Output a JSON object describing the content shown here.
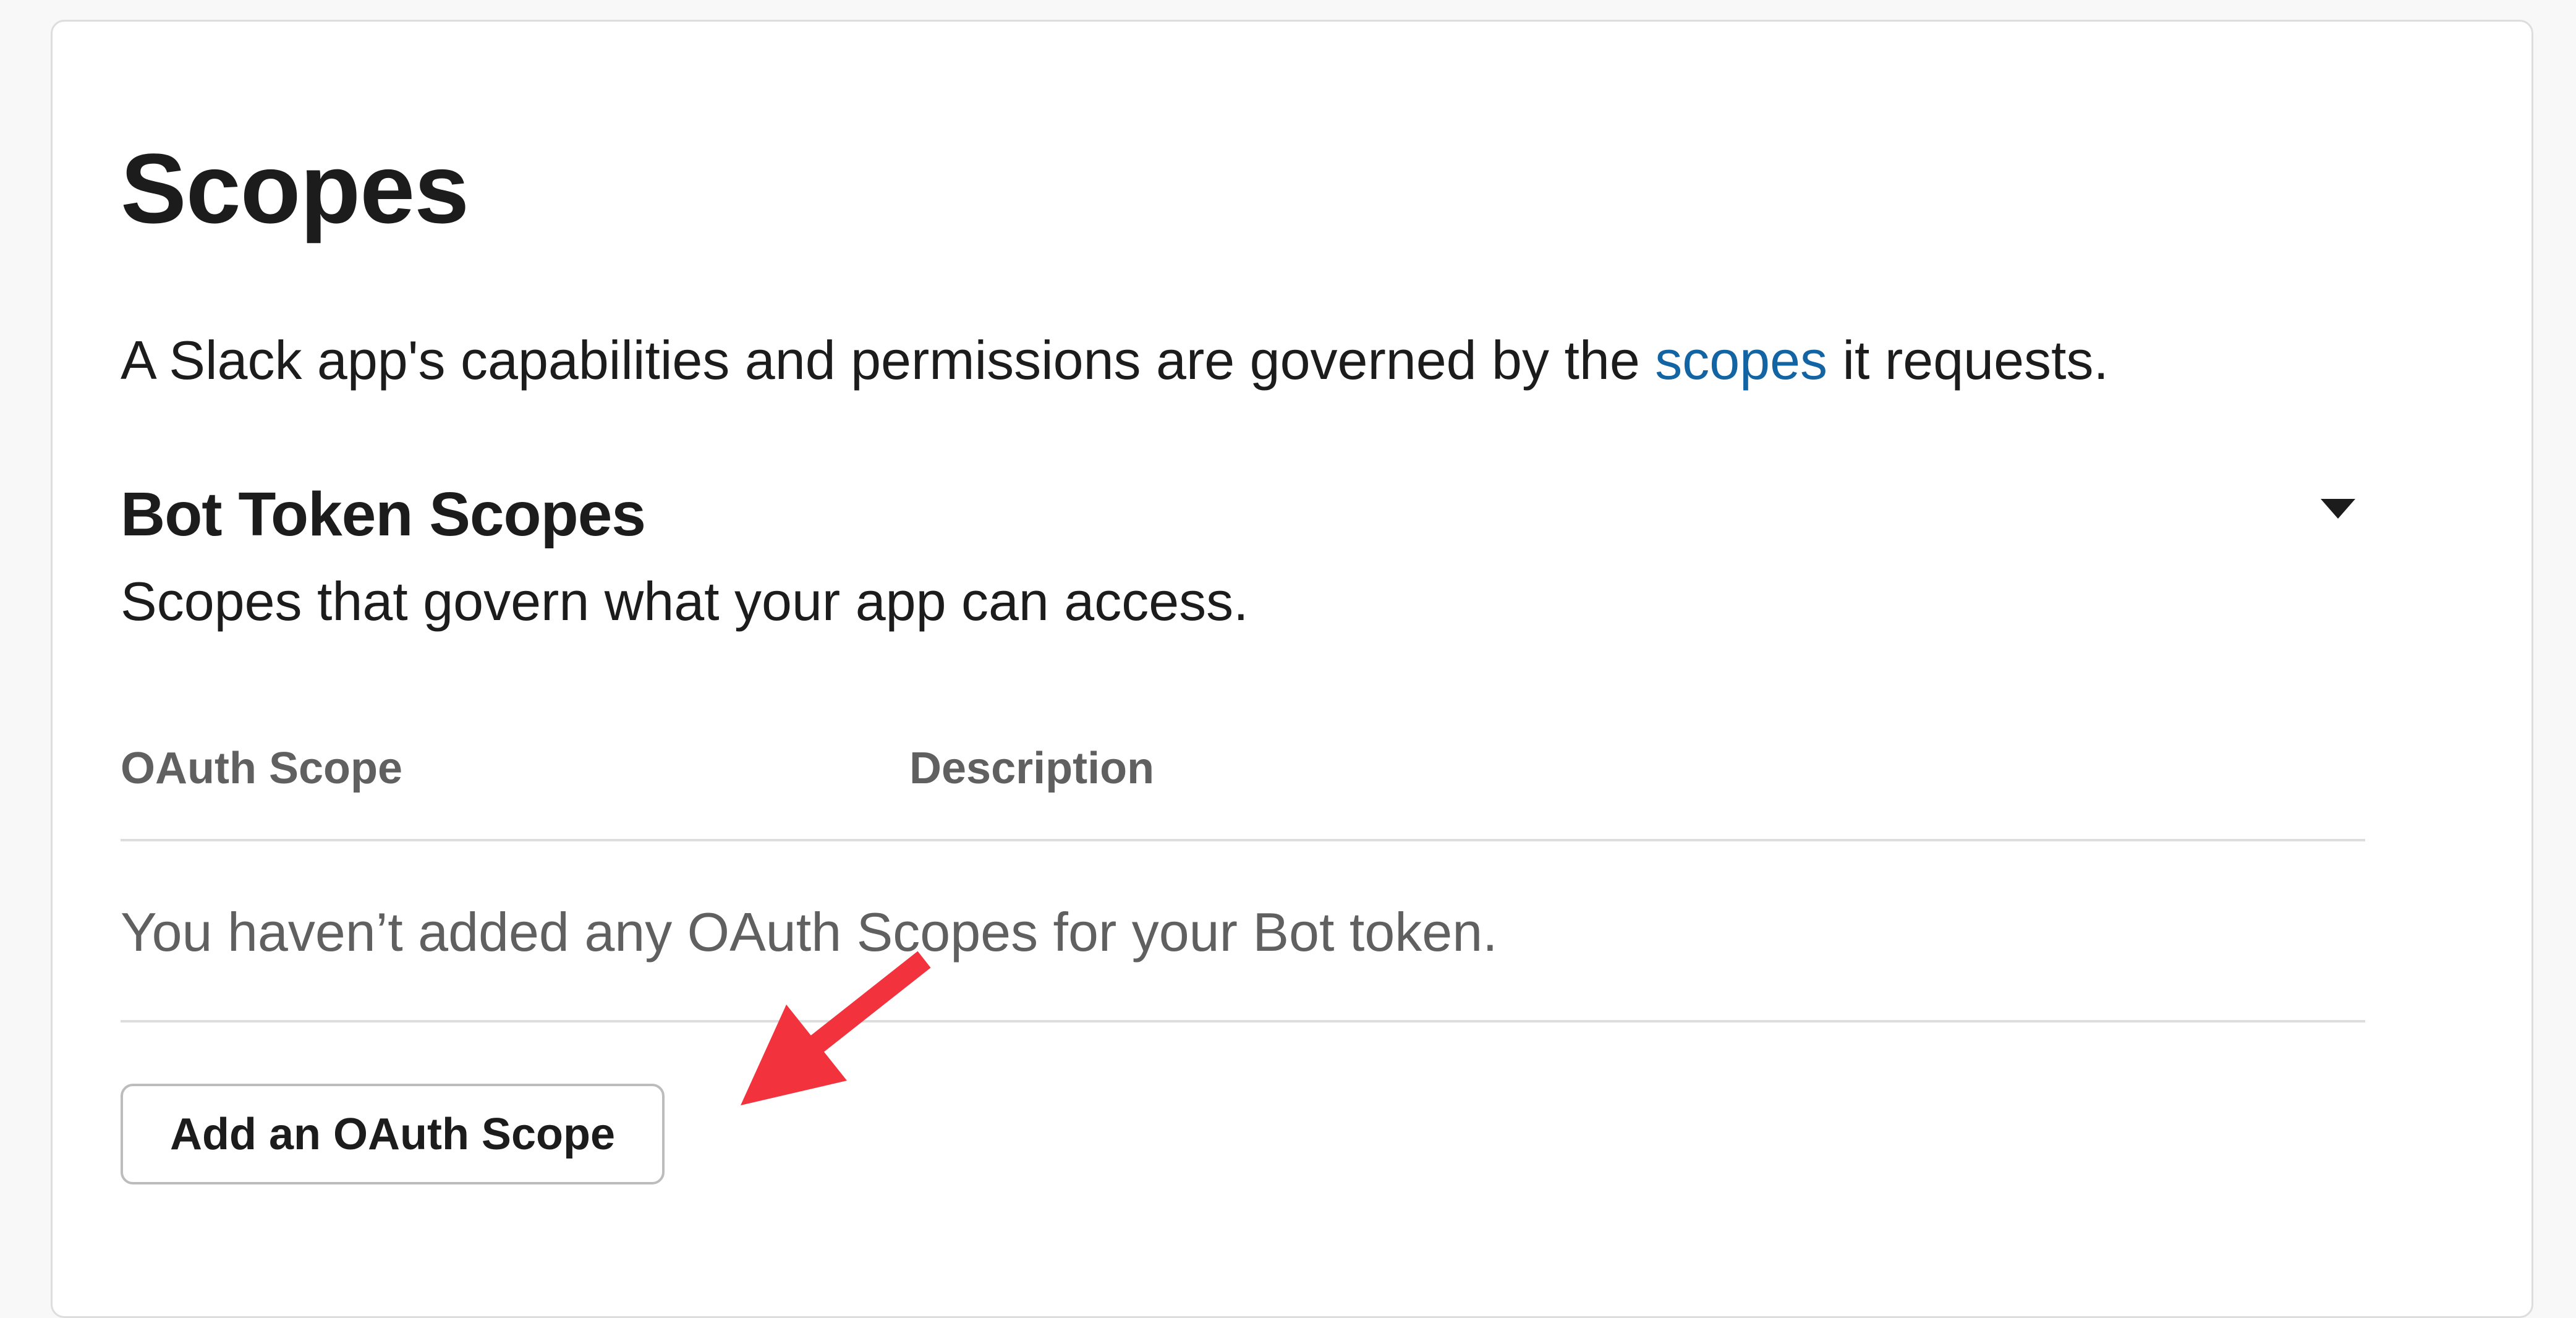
{
  "section": {
    "title": "Scopes",
    "intro_before": "A Slack app's capabilities and permissions are governed by the ",
    "intro_link": "scopes",
    "intro_after": " it requests."
  },
  "bot_token_scopes": {
    "title": "Bot Token Scopes",
    "subtitle": "Scopes that govern what your app can access.",
    "collapse_icon": "caret-down-icon",
    "table": {
      "columns": [
        "OAuth Scope",
        "Description"
      ],
      "empty_message": "You haven’t added any OAuth Scopes for your Bot token."
    },
    "add_button_label": "Add an OAuth Scope"
  },
  "annotation": {
    "icon": "red-arrow-icon",
    "color": "#f2323c"
  },
  "colors": {
    "link": "#1264a3",
    "muted_text": "#616061",
    "border": "#dddddd"
  }
}
